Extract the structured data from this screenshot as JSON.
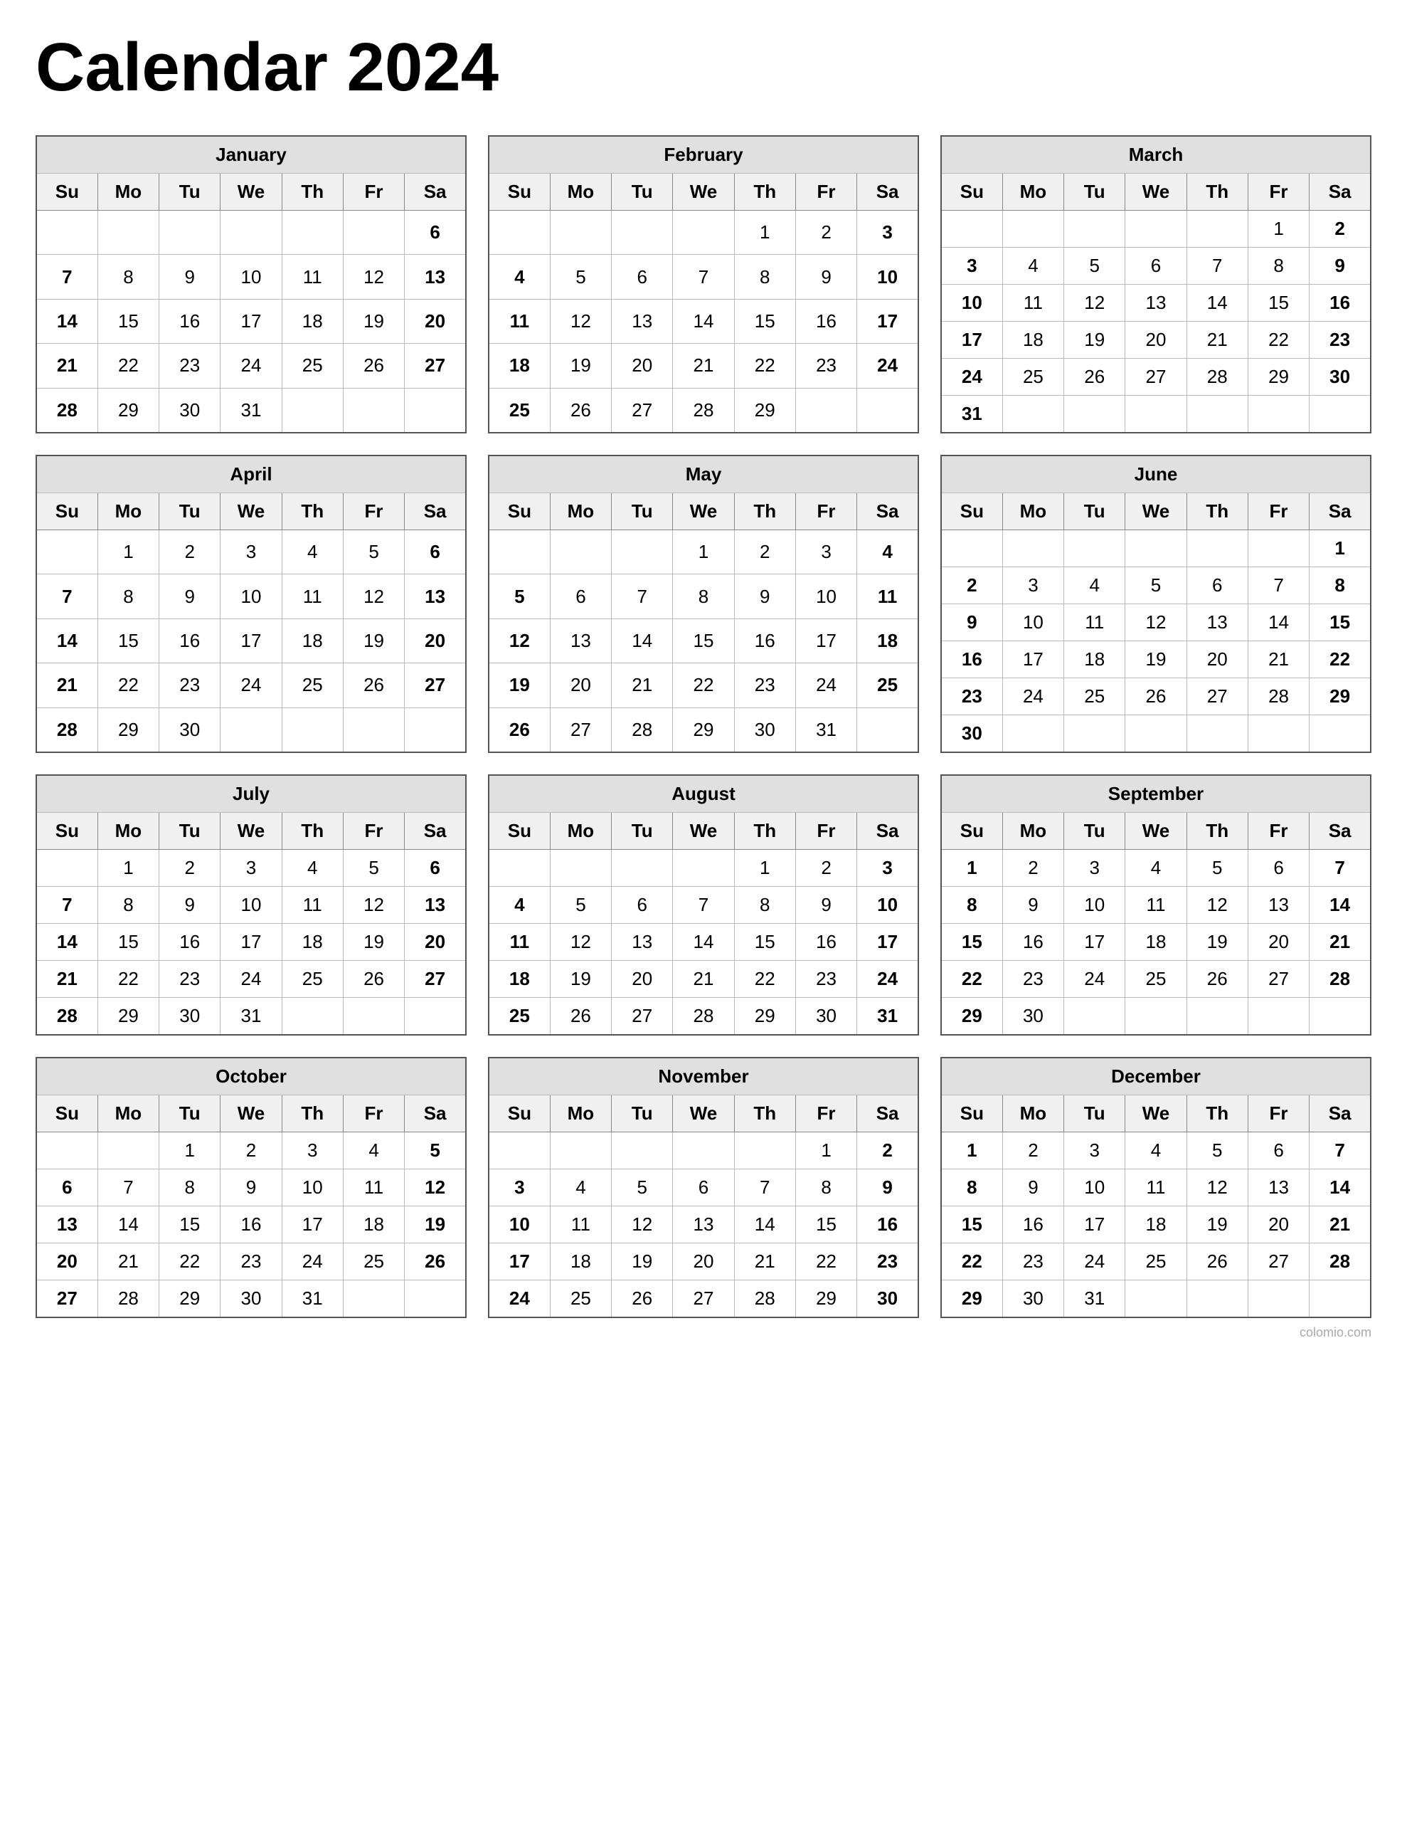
{
  "title": "Calendar 2024",
  "watermark": "colomio.com",
  "months": [
    {
      "name": "January",
      "weeks": [
        [
          "",
          "",
          "",
          "",
          "",
          "",
          "6"
        ],
        [
          "7",
          "8",
          "9",
          "10",
          "11",
          "12",
          "13"
        ],
        [
          "14",
          "15",
          "16",
          "17",
          "18",
          "19",
          "20"
        ],
        [
          "21",
          "22",
          "23",
          "24",
          "25",
          "26",
          "27"
        ],
        [
          "28",
          "29",
          "30",
          "31",
          "",
          "",
          ""
        ]
      ]
    },
    {
      "name": "February",
      "weeks": [
        [
          "",
          "",
          "",
          "",
          "1",
          "2",
          "3"
        ],
        [
          "4",
          "5",
          "6",
          "7",
          "8",
          "9",
          "10"
        ],
        [
          "11",
          "12",
          "13",
          "14",
          "15",
          "16",
          "17"
        ],
        [
          "18",
          "19",
          "20",
          "21",
          "22",
          "23",
          "24"
        ],
        [
          "25",
          "26",
          "27",
          "28",
          "29",
          "",
          ""
        ]
      ]
    },
    {
      "name": "March",
      "weeks": [
        [
          "",
          "",
          "",
          "",
          "",
          "1",
          "2"
        ],
        [
          "3",
          "4",
          "5",
          "6",
          "7",
          "8",
          "9"
        ],
        [
          "10",
          "11",
          "12",
          "13",
          "14",
          "15",
          "16"
        ],
        [
          "17",
          "18",
          "19",
          "20",
          "21",
          "22",
          "23"
        ],
        [
          "24",
          "25",
          "26",
          "27",
          "28",
          "29",
          "30"
        ],
        [
          "31",
          "",
          "",
          "",
          "",
          "",
          ""
        ]
      ]
    },
    {
      "name": "April",
      "weeks": [
        [
          "",
          "1",
          "2",
          "3",
          "4",
          "5",
          "6"
        ],
        [
          "7",
          "8",
          "9",
          "10",
          "11",
          "12",
          "13"
        ],
        [
          "14",
          "15",
          "16",
          "17",
          "18",
          "19",
          "20"
        ],
        [
          "21",
          "22",
          "23",
          "24",
          "25",
          "26",
          "27"
        ],
        [
          "28",
          "29",
          "30",
          "",
          "",
          "",
          ""
        ]
      ]
    },
    {
      "name": "May",
      "weeks": [
        [
          "",
          "",
          "",
          "1",
          "2",
          "3",
          "4"
        ],
        [
          "5",
          "6",
          "7",
          "8",
          "9",
          "10",
          "11"
        ],
        [
          "12",
          "13",
          "14",
          "15",
          "16",
          "17",
          "18"
        ],
        [
          "19",
          "20",
          "21",
          "22",
          "23",
          "24",
          "25"
        ],
        [
          "26",
          "27",
          "28",
          "29",
          "30",
          "31",
          ""
        ]
      ]
    },
    {
      "name": "June",
      "weeks": [
        [
          "",
          "",
          "",
          "",
          "",
          "",
          "1"
        ],
        [
          "2",
          "3",
          "4",
          "5",
          "6",
          "7",
          "8"
        ],
        [
          "9",
          "10",
          "11",
          "12",
          "13",
          "14",
          "15"
        ],
        [
          "16",
          "17",
          "18",
          "19",
          "20",
          "21",
          "22"
        ],
        [
          "23",
          "24",
          "25",
          "26",
          "27",
          "28",
          "29"
        ],
        [
          "30",
          "",
          "",
          "",
          "",
          "",
          ""
        ]
      ]
    },
    {
      "name": "July",
      "weeks": [
        [
          "",
          "1",
          "2",
          "3",
          "4",
          "5",
          "6"
        ],
        [
          "7",
          "8",
          "9",
          "10",
          "11",
          "12",
          "13"
        ],
        [
          "14",
          "15",
          "16",
          "17",
          "18",
          "19",
          "20"
        ],
        [
          "21",
          "22",
          "23",
          "24",
          "25",
          "26",
          "27"
        ],
        [
          "28",
          "29",
          "30",
          "31",
          "",
          "",
          ""
        ]
      ]
    },
    {
      "name": "August",
      "weeks": [
        [
          "",
          "",
          "",
          "",
          "1",
          "2",
          "3"
        ],
        [
          "4",
          "5",
          "6",
          "7",
          "8",
          "9",
          "10"
        ],
        [
          "11",
          "12",
          "13",
          "14",
          "15",
          "16",
          "17"
        ],
        [
          "18",
          "19",
          "20",
          "21",
          "22",
          "23",
          "24"
        ],
        [
          "25",
          "26",
          "27",
          "28",
          "29",
          "30",
          "31"
        ]
      ]
    },
    {
      "name": "September",
      "weeks": [
        [
          "1",
          "2",
          "3",
          "4",
          "5",
          "6",
          "7"
        ],
        [
          "8",
          "9",
          "10",
          "11",
          "12",
          "13",
          "14"
        ],
        [
          "15",
          "16",
          "17",
          "18",
          "19",
          "20",
          "21"
        ],
        [
          "22",
          "23",
          "24",
          "25",
          "26",
          "27",
          "28"
        ],
        [
          "29",
          "30",
          "",
          "",
          "",
          "",
          ""
        ]
      ]
    },
    {
      "name": "October",
      "weeks": [
        [
          "",
          "",
          "1",
          "2",
          "3",
          "4",
          "5"
        ],
        [
          "6",
          "7",
          "8",
          "9",
          "10",
          "11",
          "12"
        ],
        [
          "13",
          "14",
          "15",
          "16",
          "17",
          "18",
          "19"
        ],
        [
          "20",
          "21",
          "22",
          "23",
          "24",
          "25",
          "26"
        ],
        [
          "27",
          "28",
          "29",
          "30",
          "31",
          "",
          ""
        ]
      ]
    },
    {
      "name": "November",
      "weeks": [
        [
          "",
          "",
          "",
          "",
          "",
          "1",
          "2"
        ],
        [
          "3",
          "4",
          "5",
          "6",
          "7",
          "8",
          "9"
        ],
        [
          "10",
          "11",
          "12",
          "13",
          "14",
          "15",
          "16"
        ],
        [
          "17",
          "18",
          "19",
          "20",
          "21",
          "22",
          "23"
        ],
        [
          "24",
          "25",
          "26",
          "27",
          "28",
          "29",
          "30"
        ]
      ]
    },
    {
      "name": "December",
      "weeks": [
        [
          "1",
          "2",
          "3",
          "4",
          "5",
          "6",
          "7"
        ],
        [
          "8",
          "9",
          "10",
          "11",
          "12",
          "13",
          "14"
        ],
        [
          "15",
          "16",
          "17",
          "18",
          "19",
          "20",
          "21"
        ],
        [
          "22",
          "23",
          "24",
          "25",
          "26",
          "27",
          "28"
        ],
        [
          "29",
          "30",
          "31",
          "",
          "",
          "",
          ""
        ]
      ]
    }
  ],
  "days": [
    "Su",
    "Mo",
    "Tu",
    "We",
    "Th",
    "Fr",
    "Sa"
  ]
}
